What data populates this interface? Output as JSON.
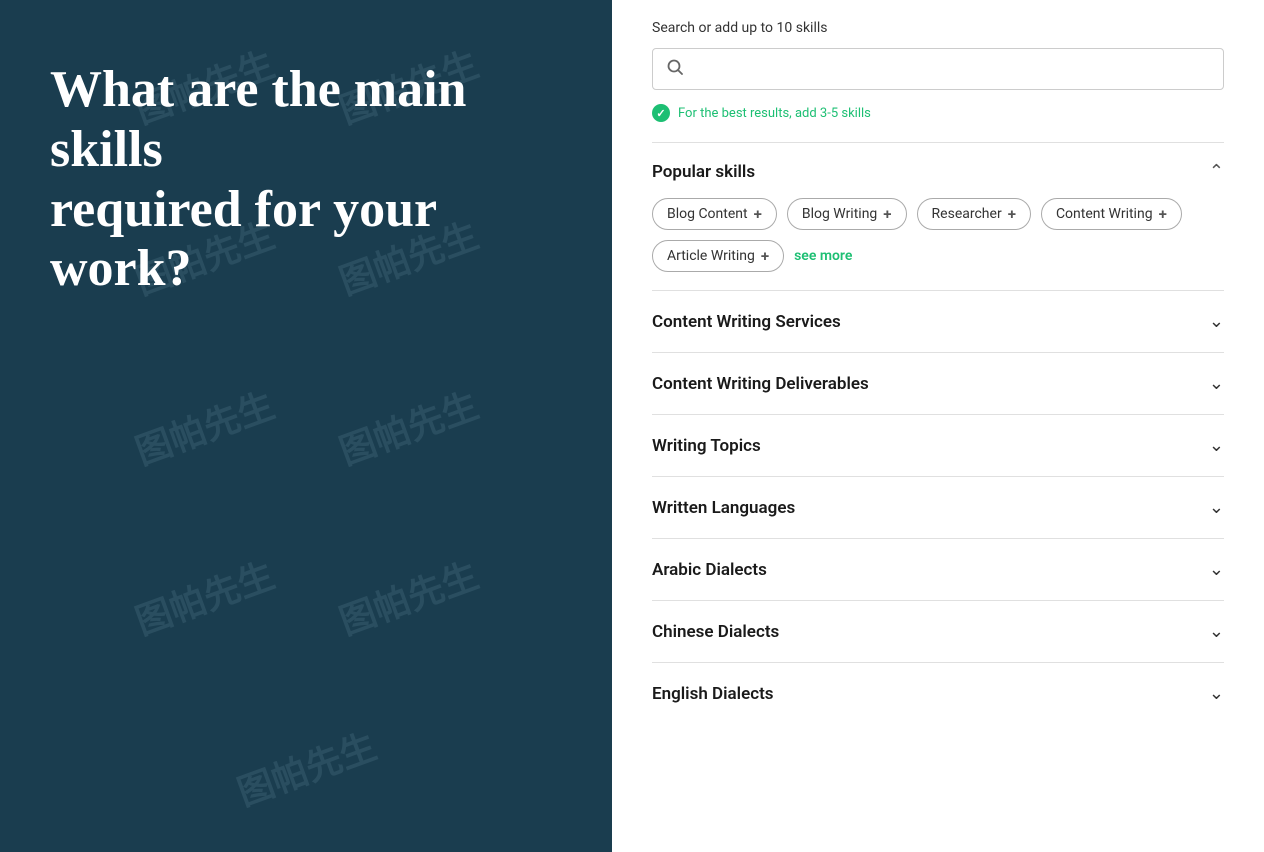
{
  "left": {
    "heading_line1": "What are the main skills",
    "heading_line2": "required for your work?"
  },
  "right": {
    "search_label": "Search or add up to 10 skills",
    "search_placeholder": "",
    "hint_text": "For the best results, add 3-5 skills",
    "popular_skills": {
      "section_title": "Popular skills",
      "skills": [
        {
          "label": "Blog Content",
          "id": "blog-content"
        },
        {
          "label": "Blog Writing",
          "id": "blog-writing"
        },
        {
          "label": "Researcher",
          "id": "researcher"
        },
        {
          "label": "Content Writing",
          "id": "content-writing"
        },
        {
          "label": "Article Writing",
          "id": "article-writing"
        }
      ],
      "see_more_label": "see more"
    },
    "collapsible_sections": [
      {
        "id": "content-writing-services",
        "title": "Content Writing Services"
      },
      {
        "id": "content-writing-deliverables",
        "title": "Content Writing Deliverables"
      },
      {
        "id": "writing-topics",
        "title": "Writing Topics"
      },
      {
        "id": "written-languages",
        "title": "Written Languages"
      },
      {
        "id": "arabic-dialects",
        "title": "Arabic Dialects"
      },
      {
        "id": "chinese-dialects",
        "title": "Chinese Dialects"
      },
      {
        "id": "english-dialects",
        "title": "English Dialects"
      }
    ]
  },
  "watermark_text": "图帕先生"
}
